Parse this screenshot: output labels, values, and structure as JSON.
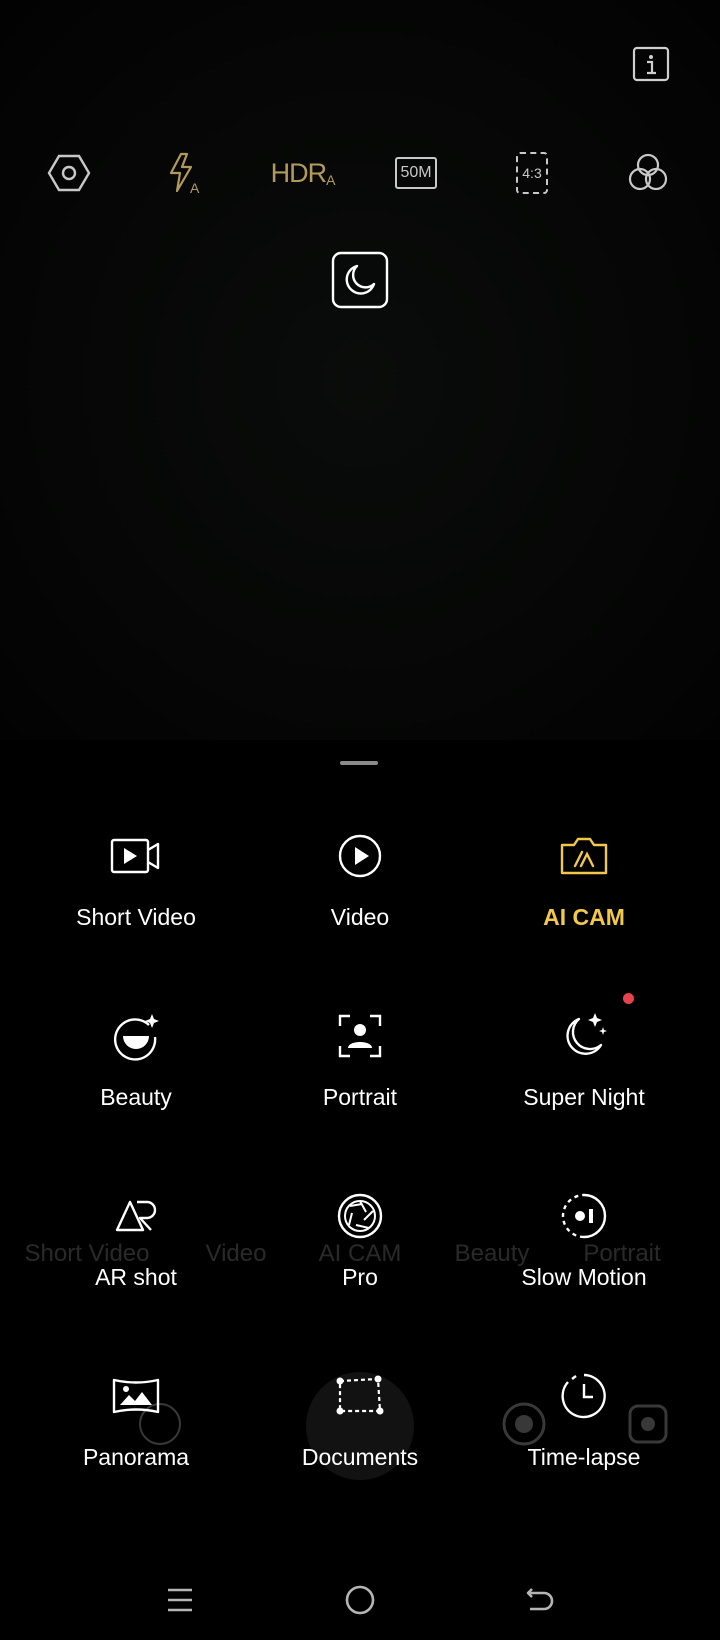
{
  "top": {
    "info_icon": "info-icon",
    "toolbar": [
      {
        "name": "settings-icon",
        "label": ""
      },
      {
        "name": "flash-auto-icon",
        "label": "A"
      },
      {
        "name": "hdr-auto-icon",
        "label": "HDR",
        "sub": "A"
      },
      {
        "name": "resolution-icon",
        "label": "50M"
      },
      {
        "name": "aspect-ratio-icon",
        "label": "4:3"
      },
      {
        "name": "filters-icon",
        "label": ""
      }
    ],
    "night_toggle_icon": "moon-icon"
  },
  "background_strip": {
    "labels": [
      "Short Video",
      "Video",
      "AI CAM",
      "Beauty",
      "Portrait"
    ]
  },
  "modes": [
    {
      "label": "Short Video",
      "icon": "short-video-icon",
      "active": false
    },
    {
      "label": "Video",
      "icon": "video-play-icon",
      "active": false
    },
    {
      "label": "AI CAM",
      "icon": "ai-camera-icon",
      "active": true
    },
    {
      "label": "Beauty",
      "icon": "beauty-icon",
      "active": false
    },
    {
      "label": "Portrait",
      "icon": "portrait-icon",
      "active": false
    },
    {
      "label": "Super Night",
      "icon": "super-night-icon",
      "active": false,
      "new_badge": true
    },
    {
      "label": "AR shot",
      "icon": "ar-icon",
      "active": false
    },
    {
      "label": "Pro",
      "icon": "aperture-icon",
      "active": false
    },
    {
      "label": "Slow Motion",
      "icon": "slow-motion-icon",
      "active": false
    },
    {
      "label": "Panorama",
      "icon": "panorama-icon",
      "active": false
    },
    {
      "label": "Documents",
      "icon": "documents-icon",
      "active": false
    },
    {
      "label": "Time-lapse",
      "icon": "time-lapse-icon",
      "active": false
    }
  ],
  "colors": {
    "accent": "#f2c84b",
    "toolbar_gold": "#b39a5c",
    "badge": "#e6444c"
  },
  "navbar": {
    "items": [
      "menu-icon",
      "home-icon",
      "back-icon"
    ]
  }
}
